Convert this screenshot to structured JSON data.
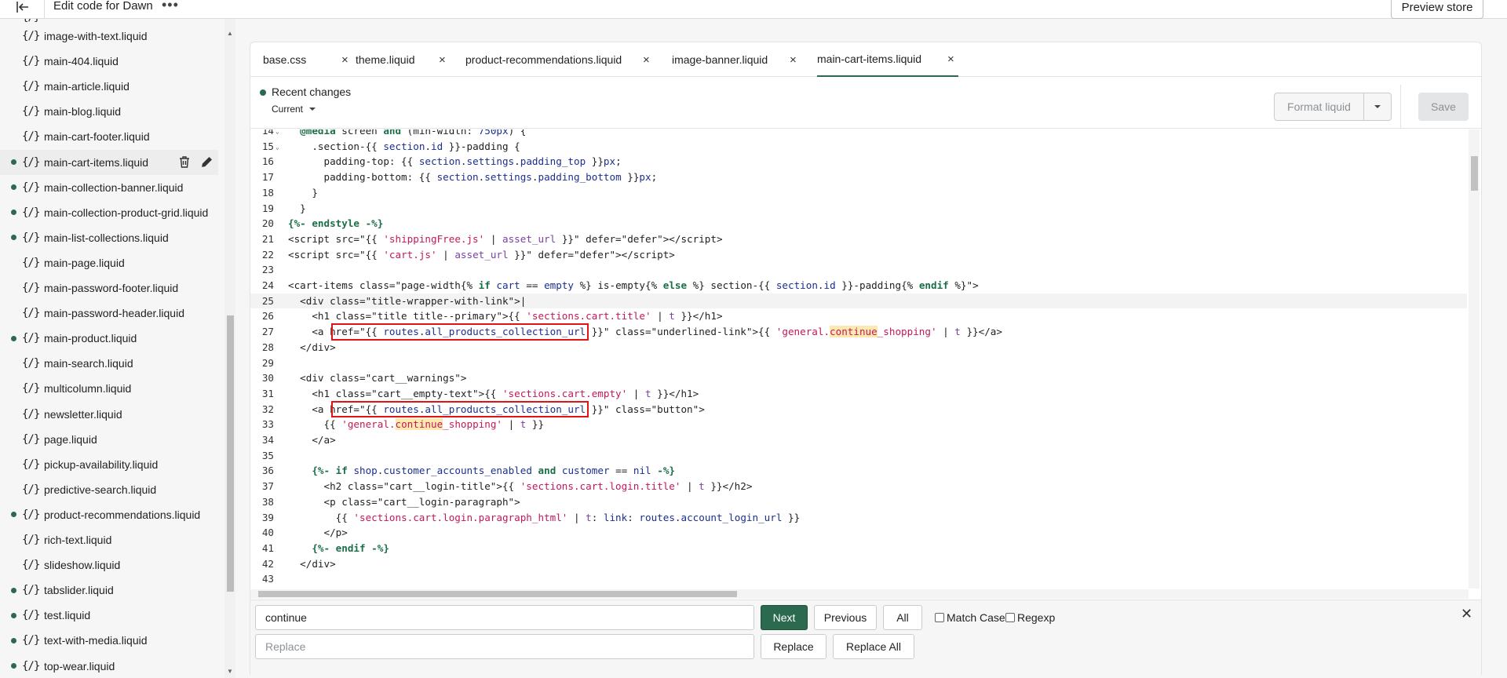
{
  "topbar": {
    "title": "Edit code for Dawn",
    "more_label": "•••",
    "preview_label": "Preview store"
  },
  "sidebar": {
    "items": [
      {
        "name": "image-with-text.liquid",
        "modified": false
      },
      {
        "name": "main-404.liquid",
        "modified": false
      },
      {
        "name": "main-article.liquid",
        "modified": false
      },
      {
        "name": "main-blog.liquid",
        "modified": false
      },
      {
        "name": "main-cart-footer.liquid",
        "modified": false
      },
      {
        "name": "main-cart-items.liquid",
        "modified": true,
        "active": true
      },
      {
        "name": "main-collection-banner.liquid",
        "modified": true
      },
      {
        "name": "main-collection-product-grid.liquid",
        "modified": true
      },
      {
        "name": "main-list-collections.liquid",
        "modified": true
      },
      {
        "name": "main-page.liquid",
        "modified": false
      },
      {
        "name": "main-password-footer.liquid",
        "modified": false
      },
      {
        "name": "main-password-header.liquid",
        "modified": false
      },
      {
        "name": "main-product.liquid",
        "modified": true
      },
      {
        "name": "main-search.liquid",
        "modified": false
      },
      {
        "name": "multicolumn.liquid",
        "modified": false
      },
      {
        "name": "newsletter.liquid",
        "modified": false
      },
      {
        "name": "page.liquid",
        "modified": false
      },
      {
        "name": "pickup-availability.liquid",
        "modified": false
      },
      {
        "name": "predictive-search.liquid",
        "modified": false
      },
      {
        "name": "product-recommendations.liquid",
        "modified": true
      },
      {
        "name": "rich-text.liquid",
        "modified": false
      },
      {
        "name": "slideshow.liquid",
        "modified": false
      },
      {
        "name": "tabslider.liquid",
        "modified": true
      },
      {
        "name": "test.liquid",
        "modified": true
      },
      {
        "name": "text-with-media.liquid",
        "modified": true
      },
      {
        "name": "top-wear.liquid",
        "modified": true
      }
    ],
    "icon_text": "{/}"
  },
  "tabs": [
    {
      "label": "base.css"
    },
    {
      "label": "theme.liquid"
    },
    {
      "label": "product-recommendations.liquid"
    },
    {
      "label": "image-banner.liquid"
    },
    {
      "label": "main-cart-items.liquid",
      "active": true
    }
  ],
  "toolbar": {
    "recent_changes": "Recent changes",
    "current": "Current",
    "format_label": "Format liquid",
    "save_label": "Save"
  },
  "code_lines": [
    {
      "n": "14",
      "fold": true
    },
    {
      "n": "15",
      "fold": true
    },
    {
      "n": "16"
    },
    {
      "n": "17"
    },
    {
      "n": "18"
    },
    {
      "n": "19"
    },
    {
      "n": "20"
    },
    {
      "n": "21"
    },
    {
      "n": "22"
    },
    {
      "n": "23"
    },
    {
      "n": "24"
    },
    {
      "n": "25"
    },
    {
      "n": "26"
    },
    {
      "n": "27"
    },
    {
      "n": "28"
    },
    {
      "n": "29"
    },
    {
      "n": "30"
    },
    {
      "n": "31"
    },
    {
      "n": "32"
    },
    {
      "n": "33"
    },
    {
      "n": "34"
    },
    {
      "n": "35"
    },
    {
      "n": "36"
    },
    {
      "n": "37"
    },
    {
      "n": "38"
    },
    {
      "n": "39"
    },
    {
      "n": "40"
    },
    {
      "n": "41"
    },
    {
      "n": "42"
    },
    {
      "n": "43"
    }
  ],
  "search": {
    "find_value": "continue",
    "replace_placeholder": "Replace",
    "next_label": "Next",
    "previous_label": "Previous",
    "all_label": "All",
    "match_case_label": "Match Case",
    "regexp_label": "Regexp",
    "replace_label": "Replace",
    "replace_all_label": "Replace All"
  },
  "colors": {
    "accent": "#2b6a4f",
    "highlight_box": "#e01414"
  }
}
